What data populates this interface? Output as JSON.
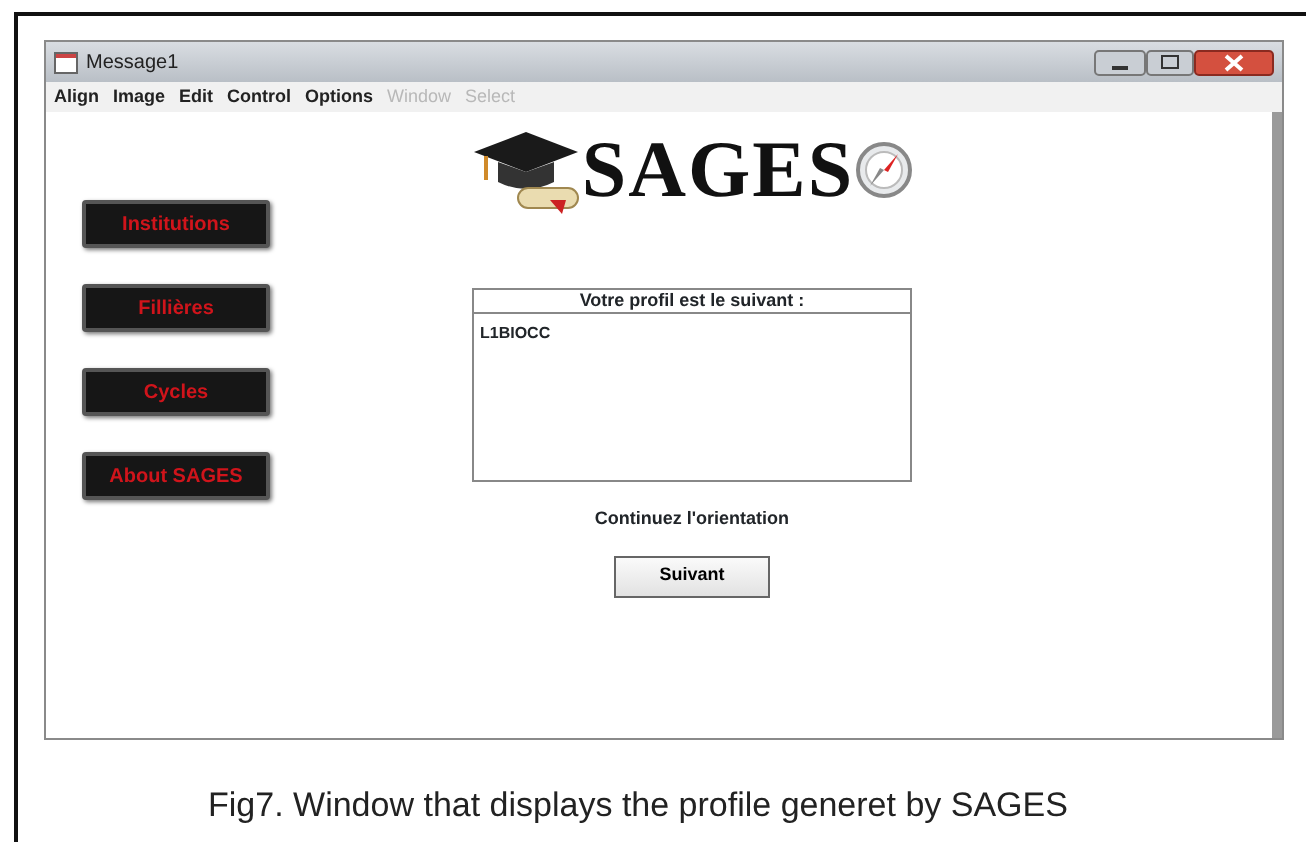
{
  "window": {
    "title": "Message1"
  },
  "menu": [
    {
      "label": "Align",
      "disabled": false
    },
    {
      "label": "Image",
      "disabled": false
    },
    {
      "label": "Edit",
      "disabled": false
    },
    {
      "label": "Control",
      "disabled": false
    },
    {
      "label": "Options",
      "disabled": false
    },
    {
      "label": "Window",
      "disabled": true
    },
    {
      "label": "Select",
      "disabled": true
    }
  ],
  "logo": {
    "text": "SAGES"
  },
  "side_buttons": [
    {
      "label": "Institutions"
    },
    {
      "label": "Fillières"
    },
    {
      "label": "Cycles"
    },
    {
      "label": "About SAGES"
    }
  ],
  "profile": {
    "header": "Votre profil est le suivant :",
    "lines": [
      "L1BIOCC"
    ]
  },
  "prompt": "Continuez l'orientation",
  "next_button": "Suivant",
  "caption": "Fig7. Window that displays the profile generet by SAGES"
}
